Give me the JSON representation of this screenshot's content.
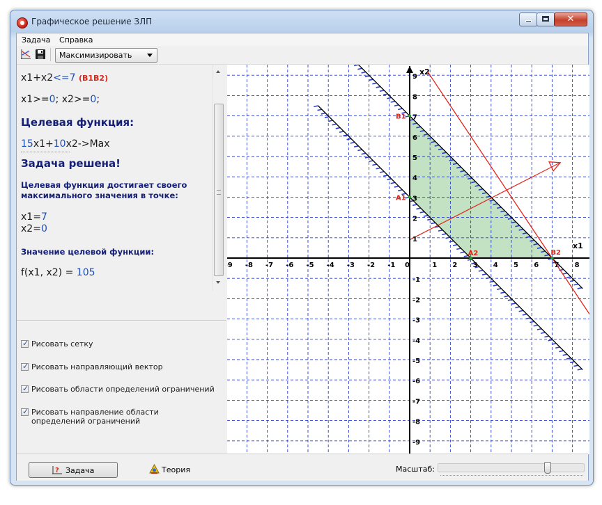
{
  "window": {
    "title": "Графическое решение ЗЛП"
  },
  "menu": {
    "items": [
      "Задача",
      "Справка"
    ]
  },
  "toolbar": {
    "mode_selected": "Максимизировать"
  },
  "solution": {
    "constraint_lhs": "x1+x2",
    "constraint_op": "<=",
    "constraint_rhs": "7",
    "constraint_tag": "(B1B2)",
    "nonneg_x1": "x1>=",
    "nonneg_x1_val": "0",
    "nonneg_sep": "; ",
    "nonneg_x2": "x2>=",
    "nonneg_x2_val": "0",
    "nonneg_end": ";",
    "objective_heading": "Целевая функция:",
    "obj_c1": "15",
    "obj_t1": "x1+",
    "obj_c2": "10",
    "obj_t2": "x2->Max",
    "solved_heading": "Задача решена!",
    "optimum_text": "Целевая функция достигает своего максимального значения в точке:",
    "x1_name": "x1=",
    "x1_value": "7",
    "x2_name": "x2=",
    "x2_value": "0",
    "value_heading": "Значение целевой функции:",
    "f_expr": "f(x1, x2) = ",
    "f_value": "105"
  },
  "options": [
    {
      "label": "Рисовать сетку",
      "checked": true
    },
    {
      "label": "Рисовать направляющий вектор",
      "checked": true
    },
    {
      "label": "Рисовать области определений ограничений",
      "checked": true
    },
    {
      "label": "Рисовать направление области определений ограничений",
      "checked": true
    }
  ],
  "bottom": {
    "task_button": "Задача",
    "theory_button": "Теория",
    "scale_label": "Масштаб:",
    "scale_value": 0.75
  },
  "plot": {
    "x_axis_label": "x1",
    "y_axis_label": "x2",
    "x_ticks": [
      -9,
      -8,
      -7,
      -6,
      -5,
      -4,
      -3,
      -2,
      -1,
      0,
      1,
      2,
      3,
      4,
      5,
      6,
      7,
      8
    ],
    "y_ticks": [
      9,
      8,
      7,
      6,
      5,
      4,
      3,
      2,
      1,
      -1,
      -2,
      -3,
      -4,
      -5,
      -6,
      -7,
      -8,
      -9
    ],
    "points": [
      {
        "name": "B1",
        "x": 0,
        "y": 7
      },
      {
        "name": "A1",
        "x": 0,
        "y": 3
      },
      {
        "name": "A2",
        "x": 3,
        "y": 0
      },
      {
        "name": "B2",
        "x": 7,
        "y": 0
      }
    ],
    "feasible_region": [
      [
        0,
        7
      ],
      [
        7,
        0
      ],
      [
        3,
        0
      ],
      [
        0,
        3
      ]
    ],
    "colors": {
      "grid": "#2b3fd0",
      "axes": "#000000",
      "constraint": "#000000",
      "hatch": "#2b3fd0",
      "objective": "#e0261b",
      "region_fill": "#b8dcb8",
      "point_label": "#e0261b"
    }
  }
}
